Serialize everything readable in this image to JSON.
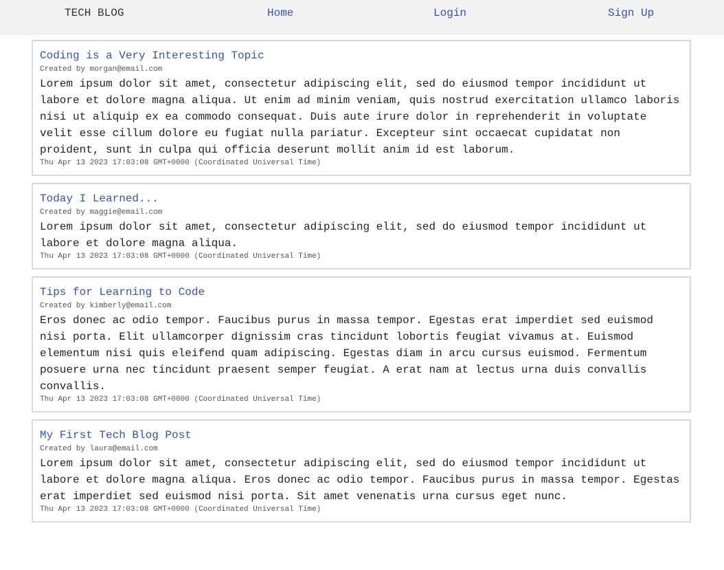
{
  "header": {
    "brand": "TECH BLOG",
    "nav": {
      "home": "Home",
      "login": "Login",
      "signup": "Sign Up"
    }
  },
  "posts": [
    {
      "title": "Coding is a Very Interesting Topic",
      "author": "Created by morgan@email.com",
      "body": "Lorem ipsum dolor sit amet, consectetur adipiscing elit, sed do eiusmod tempor incididunt ut labore et dolore magna aliqua. Ut enim ad minim veniam, quis nostrud exercitation ullamco laboris nisi ut aliquip ex ea commodo consequat. Duis aute irure dolor in reprehenderit in voluptate velit esse cillum dolore eu fugiat nulla pariatur. Excepteur sint occaecat cupidatat non proident, sunt in culpa qui officia deserunt mollit anim id est laborum.",
      "date": "Thu Apr 13 2023 17:03:08 GMT+0000 (Coordinated Universal Time)"
    },
    {
      "title": "Today I Learned...",
      "author": "Created by maggie@email.com",
      "body": "Lorem ipsum dolor sit amet, consectetur adipiscing elit, sed do eiusmod tempor incididunt ut labore et dolore magna aliqua.",
      "date": "Thu Apr 13 2023 17:03:08 GMT+0000 (Coordinated Universal Time)"
    },
    {
      "title": "Tips for Learning to Code",
      "author": "Created by kimberly@email.com",
      "body": "Eros donec ac odio tempor. Faucibus purus in massa tempor. Egestas erat imperdiet sed euismod nisi porta. Elit ullamcorper dignissim cras tincidunt lobortis feugiat vivamus at. Euismod elementum nisi quis eleifend quam adipiscing. Egestas diam in arcu cursus euismod. Fermentum posuere urna nec tincidunt praesent semper feugiat. A erat nam at lectus urna duis convallis convallis.",
      "date": "Thu Apr 13 2023 17:03:08 GMT+0000 (Coordinated Universal Time)"
    },
    {
      "title": "My First Tech Blog Post",
      "author": "Created by laura@email.com",
      "body": "Lorem ipsum dolor sit amet, consectetur adipiscing elit, sed do eiusmod tempor incididunt ut labore et dolore magna aliqua. Eros donec ac odio tempor. Faucibus purus in massa tempor. Egestas erat imperdiet sed euismod nisi porta. Sit amet venenatis urna cursus eget nunc.",
      "date": "Thu Apr 13 2023 17:03:08 GMT+0000 (Coordinated Universal Time)"
    }
  ],
  "colors": {
    "link": "#3552b6",
    "header_bg": "#f2f2f2",
    "card_border": "#d9d9d9"
  }
}
